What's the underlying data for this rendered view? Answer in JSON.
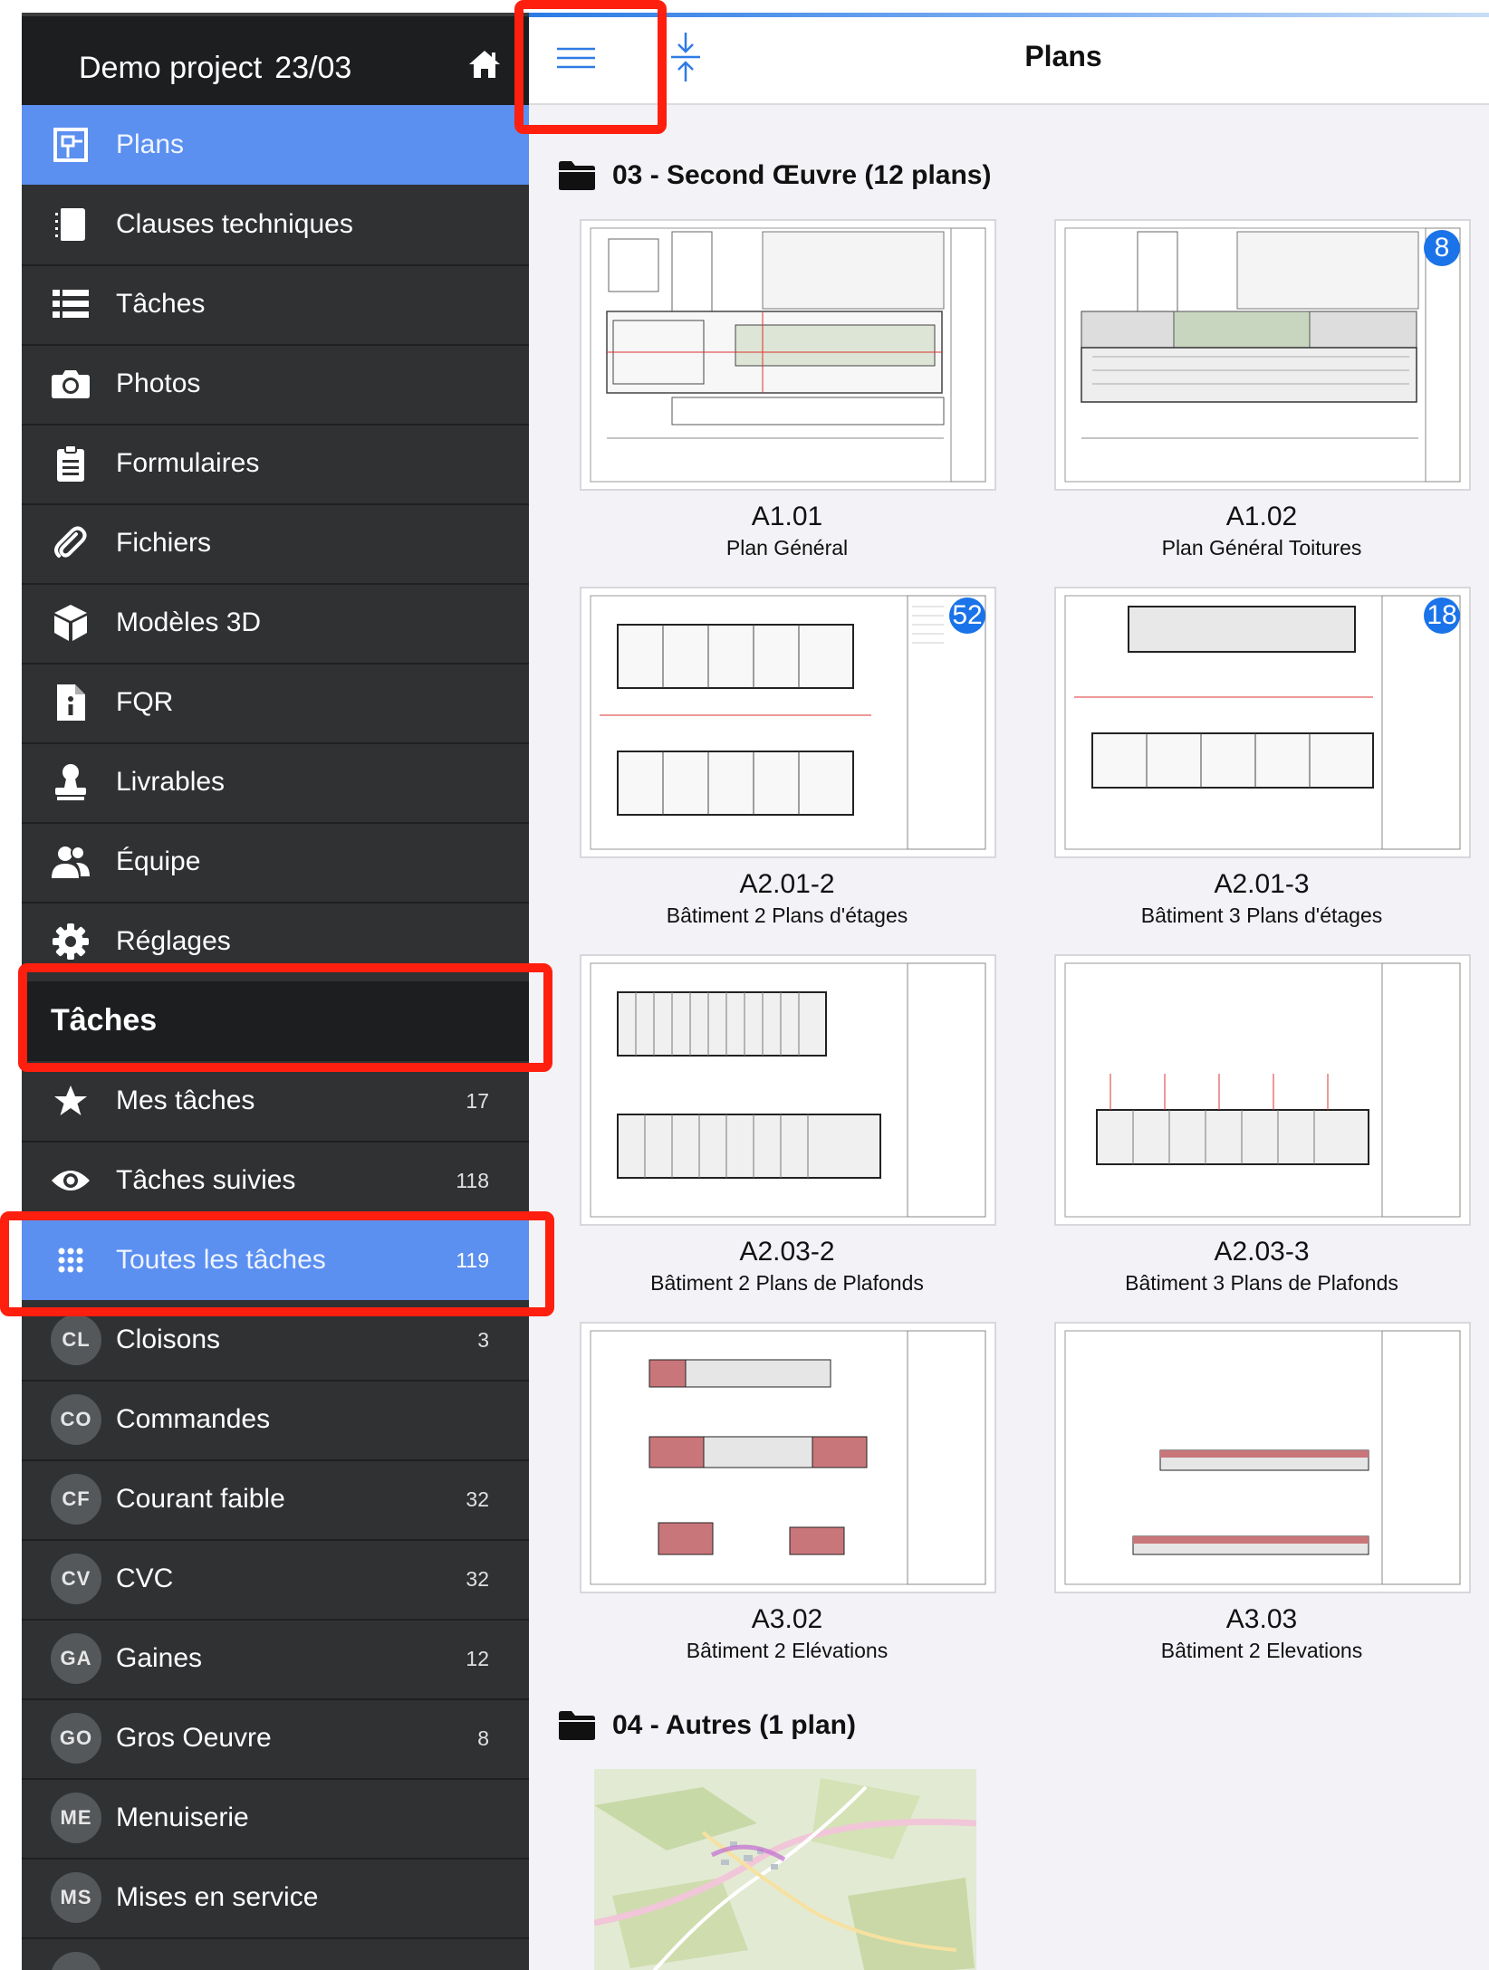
{
  "sidebar": {
    "project_title": "Demo project",
    "project_date": "23/03",
    "nav": [
      {
        "label": "Plans",
        "icon": "plans-icon",
        "active": true
      },
      {
        "label": "Clauses techniques",
        "icon": "notebook-icon"
      },
      {
        "label": "Tâches",
        "icon": "list-icon"
      },
      {
        "label": "Photos",
        "icon": "camera-icon"
      },
      {
        "label": "Formulaires",
        "icon": "clipboard-icon"
      },
      {
        "label": "Fichiers",
        "icon": "paperclip-icon"
      },
      {
        "label": "Modèles 3D",
        "icon": "cube-icon"
      },
      {
        "label": "FQR",
        "icon": "info-document-icon"
      },
      {
        "label": "Livrables",
        "icon": "stamp-icon"
      },
      {
        "label": "Équipe",
        "icon": "team-icon"
      },
      {
        "label": "Réglages",
        "icon": "gear-icon"
      }
    ],
    "section_title": "Tâches",
    "task_filters": [
      {
        "label": "Mes tâches",
        "count": "17",
        "icon": "star-icon"
      },
      {
        "label": "Tâches suivies",
        "count": "118",
        "icon": "eye-icon"
      },
      {
        "label": "Toutes les tâches",
        "count": "119",
        "icon": "grid-icon",
        "active": true
      }
    ],
    "categories": [
      {
        "abbr": "CL",
        "label": "Cloisons",
        "count": "3"
      },
      {
        "abbr": "CO",
        "label": "Commandes",
        "count": ""
      },
      {
        "abbr": "CF",
        "label": "Courant faible",
        "count": "32"
      },
      {
        "abbr": "CV",
        "label": "CVC",
        "count": "32"
      },
      {
        "abbr": "GA",
        "label": "Gaines",
        "count": "12"
      },
      {
        "abbr": "GO",
        "label": "Gros Oeuvre",
        "count": "8"
      },
      {
        "abbr": "ME",
        "label": "Menuiserie",
        "count": ""
      },
      {
        "abbr": "MS",
        "label": "Mises en service",
        "count": ""
      }
    ]
  },
  "topbar": {
    "title": "Plans",
    "menu_icon": "hamburger-icon",
    "collapse_icon": "collapse-vertical-icon"
  },
  "folders": [
    {
      "name": "03 - Second Œuvre (12 plans)",
      "plans": [
        {
          "code": "A1.01",
          "name": "Plan Général",
          "badge": "",
          "kind": "site"
        },
        {
          "code": "A1.02",
          "name": "Plan Général Toitures",
          "badge": "8",
          "kind": "site"
        },
        {
          "code": "A2.01-2",
          "name": "Bâtiment 2 Plans d'étages",
          "badge": "52",
          "kind": "floor"
        },
        {
          "code": "A2.01-3",
          "name": "Bâtiment 3 Plans d'étages",
          "badge": "18",
          "kind": "floor"
        },
        {
          "code": "A2.03-2",
          "name": "Bâtiment 2 Plans de Plafonds",
          "badge": "",
          "kind": "ceiling"
        },
        {
          "code": "A2.03-3",
          "name": "Bâtiment 3 Plans de Plafonds",
          "badge": "",
          "kind": "ceiling"
        },
        {
          "code": "A3.02",
          "name": "Bâtiment 2 Elévations",
          "badge": "",
          "kind": "elevation"
        },
        {
          "code": "A3.03",
          "name": "Bâtiment 2 Elevations",
          "badge": "",
          "kind": "elevation"
        }
      ]
    },
    {
      "name": "04 - Autres (1 plan)",
      "plans": [
        {
          "code": "",
          "name": "",
          "badge": "",
          "kind": "map"
        }
      ]
    }
  ],
  "colors": {
    "accent": "#5b8ff0",
    "sidebar_bg": "#2f3133",
    "highlight": "#ff1f0f",
    "badge": "#1a73e8"
  }
}
